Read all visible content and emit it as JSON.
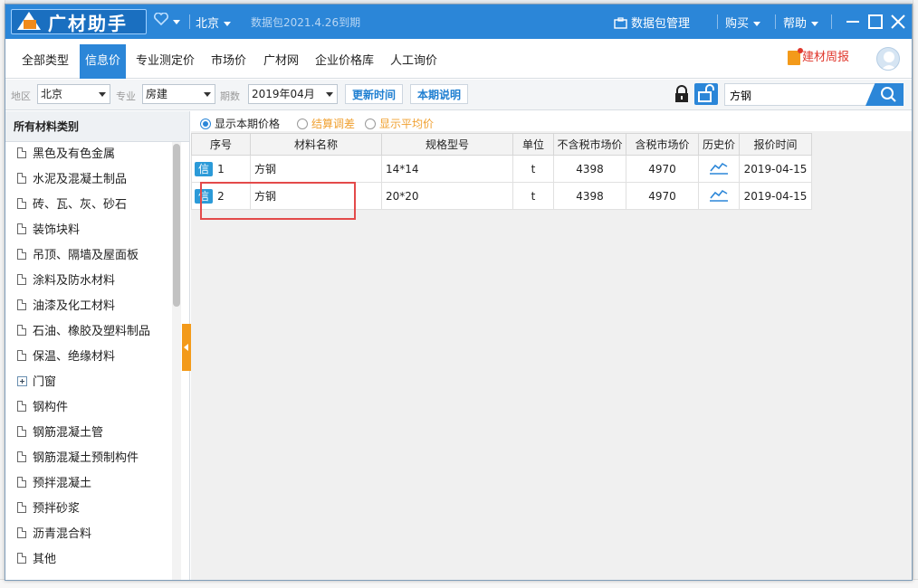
{
  "titlebar": {
    "app_name": "广材助手",
    "city": "北京",
    "expiry": "数据包2021.4.26到期",
    "data_pkg": "数据包管理",
    "buy": "购买",
    "help": "帮助"
  },
  "tabs": [
    {
      "label": "全部类型"
    },
    {
      "label": "信息价"
    },
    {
      "label": "专业测定价"
    },
    {
      "label": "市场价"
    },
    {
      "label": "广材网"
    },
    {
      "label": "企业价格库"
    },
    {
      "label": "人工询价"
    }
  ],
  "weekly": "建材周报",
  "filter": {
    "region_label": "地区",
    "region_value": "北京",
    "major_label": "专业",
    "major_value": "房建",
    "period_label": "期数",
    "period_value": "2019年04月",
    "update_btn": "更新时间",
    "explain_btn": "本期说明",
    "search_value": "方钢"
  },
  "sidebar": {
    "header": "所有材料类别",
    "items": [
      {
        "label": "黑色及有色金属",
        "icon": "doc"
      },
      {
        "label": "水泥及混凝土制品",
        "icon": "doc"
      },
      {
        "label": "砖、瓦、灰、砂石",
        "icon": "doc"
      },
      {
        "label": "装饰块料",
        "icon": "doc"
      },
      {
        "label": "吊顶、隔墙及屋面板",
        "icon": "doc"
      },
      {
        "label": "涂料及防水材料",
        "icon": "doc"
      },
      {
        "label": "油漆及化工材料",
        "icon": "doc"
      },
      {
        "label": "石油、橡胶及塑料制品",
        "icon": "doc"
      },
      {
        "label": "保温、绝缘材料",
        "icon": "doc"
      },
      {
        "label": "门窗",
        "icon": "plus"
      },
      {
        "label": "钢构件",
        "icon": "doc"
      },
      {
        "label": "钢筋混凝土管",
        "icon": "doc"
      },
      {
        "label": "钢筋混凝土预制构件",
        "icon": "doc"
      },
      {
        "label": "预拌混凝土",
        "icon": "doc"
      },
      {
        "label": "预拌砂浆",
        "icon": "doc"
      },
      {
        "label": "沥青混合料",
        "icon": "doc"
      },
      {
        "label": "其他",
        "icon": "doc"
      }
    ]
  },
  "radios": {
    "show_current": "显示本期价格",
    "settle_adjust": "结算调差",
    "show_avg": "显示平均价"
  },
  "table": {
    "headers": [
      "序号",
      "材料名称",
      "规格型号",
      "单位",
      "不含税市场价",
      "含税市场价",
      "历史价",
      "报价时间"
    ],
    "badge": "信",
    "rows": [
      {
        "idx": "1",
        "name": "方钢",
        "spec": "14*14",
        "unit": "t",
        "price_ex": "4398",
        "price_in": "4970",
        "date": "2019-04-15"
      },
      {
        "idx": "2",
        "name": "方钢",
        "spec": "20*20",
        "unit": "t",
        "price_ex": "4398",
        "price_in": "4970",
        "date": "2019-04-15"
      }
    ]
  },
  "colors": {
    "accent": "#2b86d8",
    "orange": "#f39a1a",
    "highlight": "#e34a4a"
  }
}
